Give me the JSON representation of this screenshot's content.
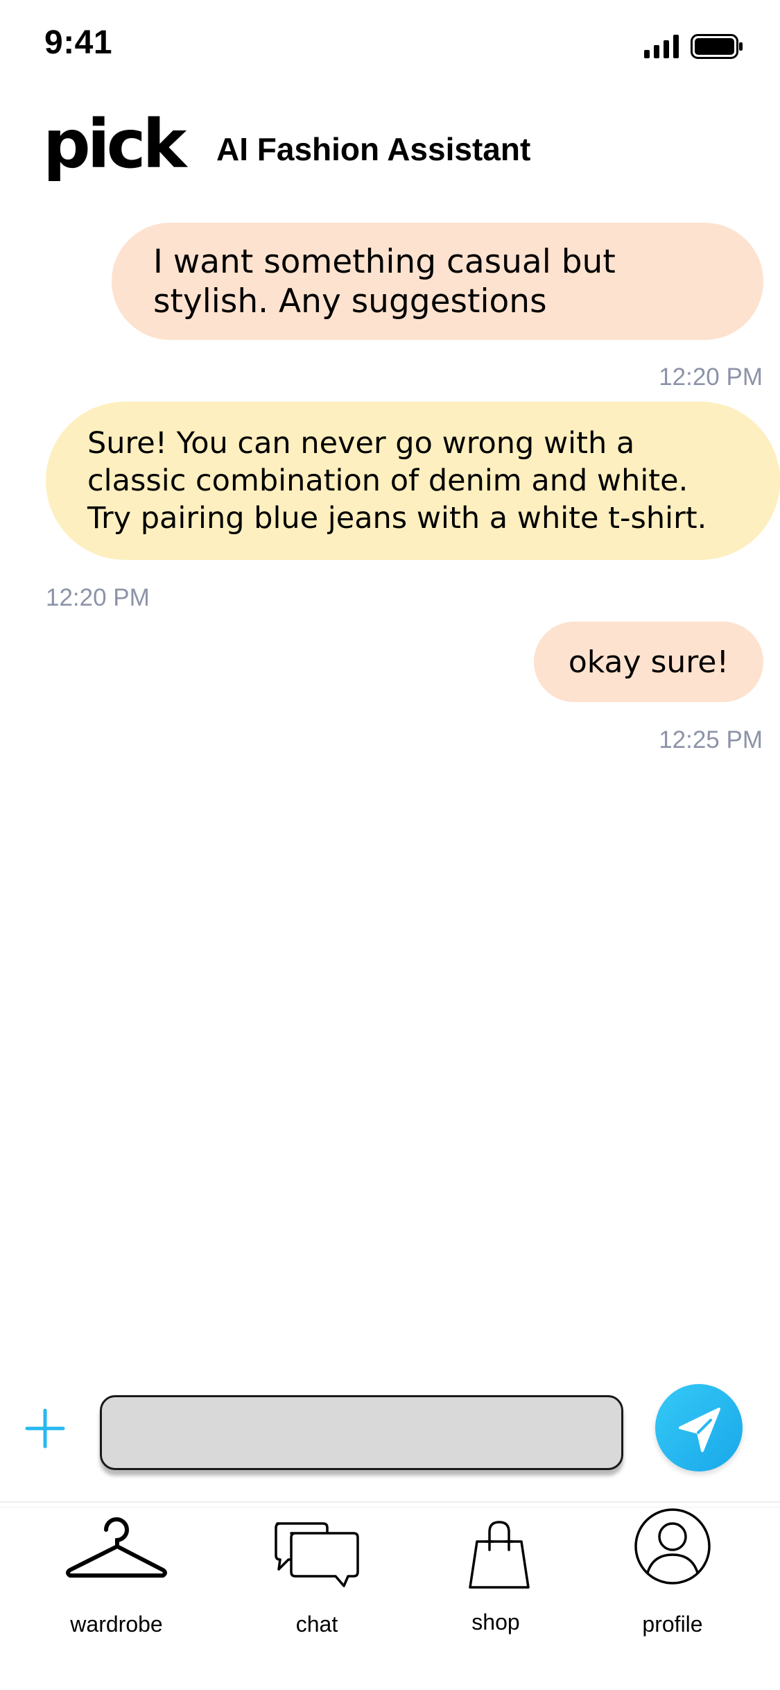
{
  "status_bar": {
    "time": "9:41"
  },
  "header": {
    "brand": "pick",
    "title": "AI Fashion Assistant"
  },
  "messages": [
    {
      "sender": "user",
      "text": "I want something casual but stylish. Any suggestions",
      "time": "12:20 PM"
    },
    {
      "sender": "assistant",
      "text": "Sure! You can never go wrong with a classic combination of denim and white. Try pairing blue jeans with a white t-shirt.",
      "time": "12:20 PM"
    },
    {
      "sender": "user",
      "text": "okay sure!",
      "time": "12:25 PM"
    }
  ],
  "composer": {
    "input_value": "",
    "add_icon": "plus-icon",
    "send_icon": "send-icon",
    "accent_color": "#27B8F0"
  },
  "bottom_nav": {
    "items": [
      {
        "label": "wardrobe",
        "icon": "hanger-icon"
      },
      {
        "label": "chat",
        "icon": "chat-bubbles-icon"
      },
      {
        "label": "shop",
        "icon": "shopping-bag-icon"
      },
      {
        "label": "profile",
        "icon": "user-circle-icon"
      }
    ]
  },
  "colors": {
    "user_bubble": "#FDE2CF",
    "assistant_bubble": "#FDEFBF",
    "timestamp": "#8C93A8"
  }
}
